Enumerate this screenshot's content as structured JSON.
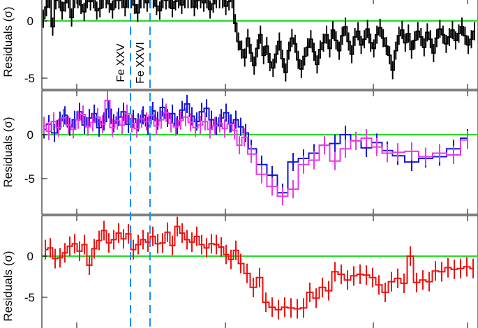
{
  "chart_data": [
    {
      "type": "line",
      "title": "",
      "ylabel": "Residuals (σ)",
      "ylim": [
        -6.2,
        2.8
      ],
      "yticks": [
        0,
        -5
      ],
      "zero_line": true,
      "annotations": [
        "Fe XXV",
        "Fe XXVI"
      ],
      "series": [
        {
          "color": "#000000",
          "style": "steps-with-errorbars",
          "values": [
            0.2,
            1.2,
            2.1,
            -0.5,
            1.8,
            2.5,
            0.9,
            1.6,
            2.2,
            0.3,
            1.9,
            2.6,
            1.4,
            0.8,
            2.3,
            1.7,
            2.4,
            0.9,
            1.1,
            2.0,
            2.7,
            1.5,
            1.0,
            2.2,
            1.8,
            2.5,
            1.2,
            2.0,
            2.6,
            1.4,
            0.7,
            1.9,
            2.4,
            1.6,
            2.1,
            2.7,
            1.3,
            0.9,
            2.2,
            1.8,
            2.5,
            1.1,
            1.7,
            2.3,
            1.4,
            1.9,
            2.6,
            2.0,
            1.2,
            1.8,
            2.4,
            1.6,
            2.2,
            1.0,
            1.5,
            2.3,
            1.9,
            2.5,
            1.3,
            1.7,
            2.0,
            -0.2,
            -1.8,
            -2.5,
            -3.2,
            -1.5,
            -2.8,
            -3.9,
            -2.4,
            -1.2,
            -3.0,
            -2.2,
            -3.6,
            -4.1,
            -2.9,
            -1.8,
            -3.3,
            -4.5,
            -2.6,
            -1.5,
            -2.0,
            -3.4,
            -4.2,
            -3.1,
            -2.3,
            -1.6,
            -2.7,
            -3.8,
            -2.5,
            -1.9,
            -1.2,
            -2.4,
            -0.8,
            -1.7,
            -2.6,
            -1.3,
            -0.5,
            -1.8,
            -2.9,
            -1.4,
            -0.9,
            -2.1,
            -1.6,
            -0.7,
            -1.9,
            -2.4,
            -1.2,
            -0.6,
            -1.5,
            -2.2,
            -3.0,
            -4.3,
            -2.6,
            -1.3,
            -0.8,
            -1.9,
            -1.1,
            -2.5,
            -1.7,
            -0.9,
            -1.4,
            -2.3,
            -1.0,
            -1.6,
            -2.8,
            -1.5,
            -0.7,
            -1.2,
            -2.0,
            -1.4,
            -0.8,
            -1.7,
            -1.1,
            -0.5,
            -1.3,
            -2.1,
            -1.6,
            -0.9
          ]
        }
      ]
    },
    {
      "type": "line",
      "title": "",
      "ylabel": "Residuals (σ)",
      "ylim": [
        -8.9,
        4.8
      ],
      "yticks": [
        0,
        -5
      ],
      "zero_line": true,
      "series": [
        {
          "color": "#1515d8",
          "style": "steps-with-errorbars",
          "x": [
            63,
            70,
            78,
            86,
            93,
            100,
            107,
            114,
            121,
            128,
            135,
            142,
            149,
            156,
            163,
            170,
            177,
            184,
            191,
            198,
            205,
            212,
            219,
            226,
            233,
            240,
            247,
            254,
            261,
            268,
            275,
            282,
            289,
            296,
            303,
            310,
            317,
            324,
            331,
            338,
            345,
            352,
            360,
            375,
            390,
            405,
            420,
            435,
            450,
            465,
            480,
            495,
            510,
            525,
            540,
            555,
            570,
            590,
            610,
            630,
            650,
            670
          ],
          "values": [
            0.6,
            1.2,
            0.2,
            1.6,
            2.2,
            0.9,
            1.7,
            2.6,
            1.1,
            1.9,
            2.4,
            0.8,
            1.5,
            2.9,
            1.3,
            2.0,
            2.6,
            1.2,
            1.8,
            1.4,
            2.2,
            1.0,
            2.7,
            1.6,
            3.1,
            1.9,
            2.4,
            1.1,
            2.8,
            3.5,
            2.1,
            1.5,
            2.6,
            3.0,
            1.7,
            1.0,
            1.9,
            2.5,
            1.3,
            1.7,
            0.9,
            0.2,
            -1.6,
            -3.4,
            -4.6,
            -6.6,
            -3.1,
            -2.7,
            -2.1,
            -1.2,
            -1.0,
            0.0,
            -0.7,
            -1.5,
            -0.9,
            -1.8,
            -2.4,
            -3.1,
            -2.7,
            -2.5,
            -1.6,
            -0.4
          ]
        },
        {
          "color": "#e83ae8",
          "style": "steps-with-errorbars",
          "x": [
            63,
            70,
            77,
            84,
            91,
            98,
            105,
            112,
            119,
            126,
            133,
            140,
            147,
            154,
            161,
            168,
            175,
            182,
            189,
            196,
            203,
            210,
            217,
            224,
            231,
            238,
            245,
            252,
            259,
            266,
            273,
            280,
            287,
            294,
            301,
            308,
            315,
            322,
            329,
            336,
            343,
            350,
            360,
            375,
            390,
            405,
            420,
            435,
            450,
            465,
            480,
            495,
            510,
            525,
            540,
            555,
            570,
            590,
            610,
            630,
            650,
            670
          ],
          "values": [
            1.0,
            0.4,
            1.5,
            0.8,
            1.9,
            1.1,
            0.6,
            1.7,
            2.3,
            0.9,
            1.4,
            2.0,
            1.2,
            3.9,
            0.8,
            1.6,
            1.1,
            2.4,
            1.3,
            0.7,
            1.8,
            1.5,
            2.2,
            1.0,
            1.7,
            2.5,
            1.3,
            0.9,
            1.6,
            2.0,
            1.4,
            0.8,
            1.1,
            1.5,
            0.6,
            1.0,
            1.3,
            0.7,
            1.2,
            0.5,
            -1.2,
            -0.3,
            -2.2,
            -4.5,
            -5.9,
            -7.0,
            -6.2,
            -3.4,
            -2.9,
            -1.2,
            -3.0,
            -1.6,
            -0.7,
            -0.4,
            -1.4,
            -2.1,
            -2.0,
            -1.9,
            -2.5,
            -2.1,
            -2.3,
            -0.6
          ]
        }
      ]
    },
    {
      "type": "line",
      "title": "",
      "ylabel": "Residuals (σ)",
      "ylim": [
        -7.1,
        4.2
      ],
      "yticks": [
        0,
        -5
      ],
      "zero_line": true,
      "series": [
        {
          "color": "#ee1111",
          "style": "steps-with-errorbars",
          "x": [
            65,
            72,
            79,
            86,
            93,
            100,
            107,
            114,
            121,
            128,
            135,
            142,
            149,
            156,
            163,
            170,
            177,
            184,
            191,
            198,
            205,
            212,
            219,
            226,
            233,
            240,
            247,
            254,
            261,
            268,
            275,
            282,
            289,
            296,
            303,
            310,
            317,
            324,
            331,
            338,
            345,
            354,
            363,
            372,
            381,
            390,
            399,
            408,
            417,
            426,
            435,
            444,
            453,
            462,
            471,
            480,
            489,
            498,
            507,
            516,
            525,
            534,
            543,
            552,
            561,
            570,
            579,
            588,
            597,
            606,
            615,
            624,
            633,
            642,
            651,
            660,
            669,
            678
          ],
          "values": [
            0.8,
            1.0,
            -0.3,
            -0.2,
            0.4,
            1.2,
            1.5,
            0.6,
            1.4,
            -1.1,
            0.9,
            1.9,
            3.1,
            1.6,
            2.0,
            2.8,
            2.1,
            2.7,
            0.8,
            1.4,
            2.0,
            1.7,
            2.4,
            1.5,
            1.6,
            2.9,
            1.3,
            3.6,
            2.8,
            2.0,
            1.7,
            2.4,
            1.4,
            1.0,
            1.5,
            1.4,
            1.1,
            0.2,
            -0.4,
            0.7,
            -0.9,
            -2.1,
            -3.8,
            -2.6,
            -5.6,
            -6.2,
            -6.5,
            -6.2,
            -6.3,
            -6.4,
            -6.3,
            -4.4,
            -5.1,
            -3.8,
            -4.2,
            -1.9,
            -2.2,
            -2.9,
            -2.4,
            -2.2,
            -2.3,
            -2.6,
            -3.5,
            -4.4,
            -3.1,
            -2.7,
            -3.3,
            0.0,
            -3.2,
            -2.9,
            -3.1,
            -1.8,
            -1.9,
            -1.4,
            -1.6,
            -1.5,
            -1.3,
            -1.5
          ]
        }
      ]
    }
  ],
  "colors": {
    "zero_line": "#22dd22",
    "marker_line": "#1a90ff",
    "axis": "#000000"
  }
}
